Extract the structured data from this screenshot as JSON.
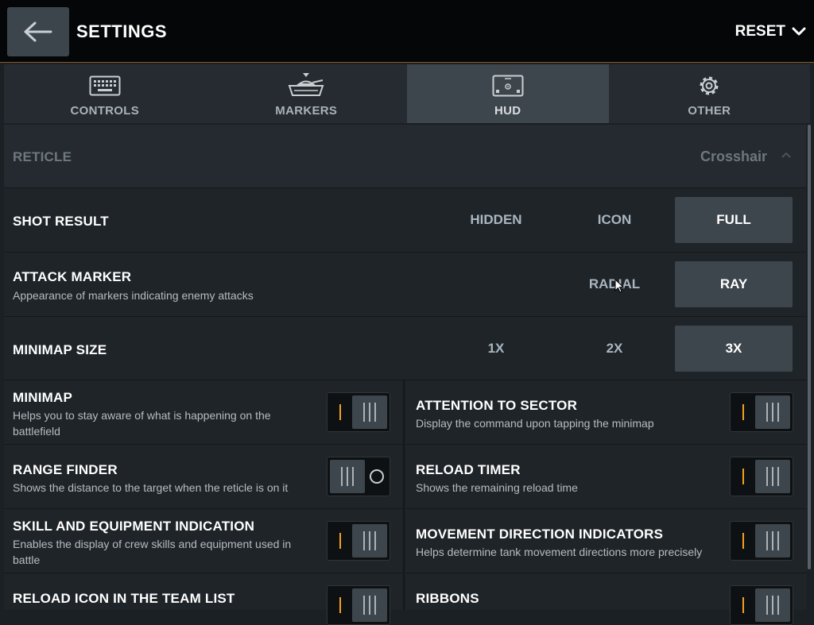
{
  "header": {
    "title": "SETTINGS",
    "reset_label": "RESET",
    "back_icon": "arrow-left-icon"
  },
  "tabs": [
    {
      "label": "CONTROLS",
      "icon": "keyboard-icon",
      "active": false
    },
    {
      "label": "MARKERS",
      "icon": "tank-icon",
      "active": false
    },
    {
      "label": "HUD",
      "icon": "screen-icon",
      "active": true
    },
    {
      "label": "OTHER",
      "icon": "gear-icon",
      "active": false
    }
  ],
  "reticle": {
    "label": "RETICLE",
    "value": "Crosshair"
  },
  "shot_result": {
    "label": "SHOT RESULT",
    "options": [
      "HIDDEN",
      "ICON",
      "FULL"
    ],
    "selected": "FULL"
  },
  "attack_marker": {
    "label": "ATTACK MARKER",
    "description": "Appearance of markers indicating enemy attacks",
    "options": [
      "RADIAL",
      "RAY"
    ],
    "selected": "RAY"
  },
  "minimap_size": {
    "label": "MINIMAP SIZE",
    "options": [
      "1X",
      "2X",
      "3X"
    ],
    "selected": "3X"
  },
  "toggles": {
    "minimap": {
      "label": "MINIMAP",
      "description": "Helps you to stay aware of what is happening on the battlefield",
      "on": true
    },
    "attention_to_sector": {
      "label": "ATTENTION TO SECTOR",
      "description": "Display the command upon tapping the minimap",
      "on": true
    },
    "range_finder": {
      "label": "RANGE FINDER",
      "description": "Shows the distance to the target when the reticle is on it",
      "on": false
    },
    "reload_timer": {
      "label": "RELOAD TIMER",
      "description": "Shows the remaining reload time",
      "on": true
    },
    "skill_equipment": {
      "label": "SKILL AND EQUIPMENT INDICATION",
      "description": "Enables the display of crew skills and equipment used in battle",
      "on": true
    },
    "movement_direction": {
      "label": "MOVEMENT DIRECTION INDICATORS",
      "description": "Helps determine tank movement directions more precisely",
      "on": true
    },
    "reload_icon_team_list": {
      "label": "RELOAD ICON IN THE TEAM LIST",
      "on": true
    },
    "ribbons": {
      "label": "RIBBONS",
      "on": true
    }
  },
  "colors": {
    "accent_orange": "#f3a021",
    "selected_bg": "#3e464d",
    "panel_bg": "#1f2428"
  }
}
